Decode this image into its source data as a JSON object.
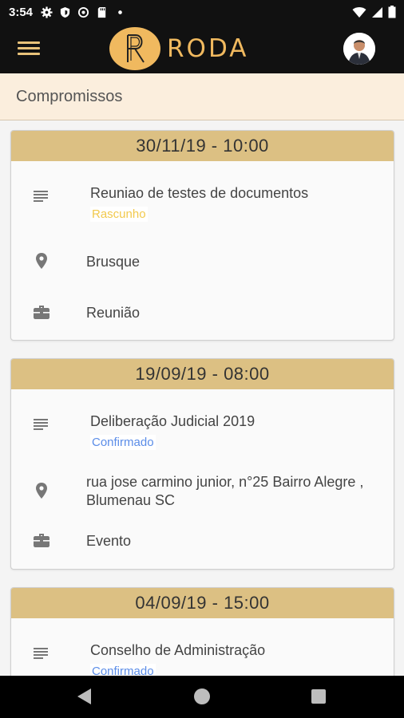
{
  "status_bar": {
    "time": "3:54"
  },
  "app": {
    "logo_text": "RODA"
  },
  "header": {
    "title": "Compromissos"
  },
  "colors": {
    "accent": "#dcc083",
    "draft": "#f2c94c",
    "confirmed": "#5b8de8",
    "header_bg": "#fbeedd"
  },
  "appointments": [
    {
      "datetime": "30/11/19 - 10:00",
      "title": "Reuniao de testes de documentos",
      "status": "Rascunho",
      "location": "Brusque",
      "type": "Reunião"
    },
    {
      "datetime": "19/09/19 - 08:00",
      "title": "Deliberação Judicial 2019",
      "status": "Confirmado",
      "location": "rua jose carmino junior, n°25 Bairro Alegre , Blumenau SC",
      "type": "Evento"
    },
    {
      "datetime": "04/09/19 - 15:00",
      "title": "Conselho de Administração",
      "status": "Confirmado"
    }
  ]
}
